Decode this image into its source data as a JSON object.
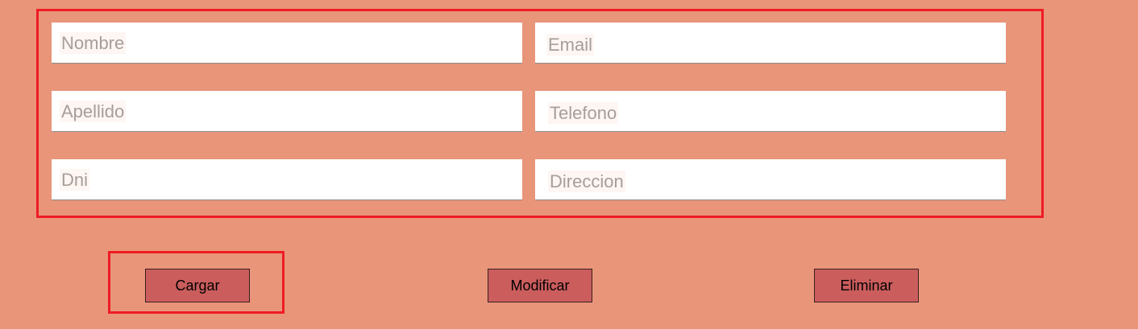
{
  "form": {
    "fields": {
      "nombre": {
        "placeholder": "Nombre"
      },
      "email": {
        "placeholder": "Email"
      },
      "apellido": {
        "placeholder": "Apellido"
      },
      "telefono": {
        "placeholder": "Telefono"
      },
      "dni": {
        "placeholder": "Dni"
      },
      "direccion": {
        "placeholder": "Direccion"
      }
    }
  },
  "actions": {
    "cargar_label": "Cargar",
    "modificar_label": "Modificar",
    "eliminar_label": "Eliminar"
  },
  "colors": {
    "background": "#e99579",
    "highlight_border": "#ee1c24",
    "button": "#cb5d5d"
  }
}
